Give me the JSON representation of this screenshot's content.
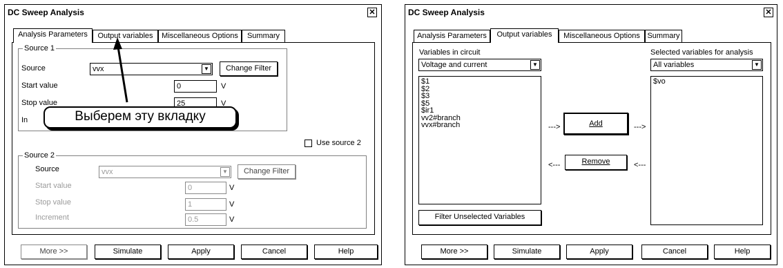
{
  "left_dialog": {
    "title": "DC Sweep Analysis",
    "close_glyph": "✕",
    "tabs": [
      {
        "label": "Analysis Parameters"
      },
      {
        "label": "Output variables"
      },
      {
        "label": "Miscellaneous Options"
      },
      {
        "label": "Summary"
      }
    ],
    "source1": {
      "legend": "Source 1",
      "source_label": "Source",
      "source_value": "vvx",
      "change_filter": "Change Filter",
      "start_label": "Start value",
      "start_value": "0",
      "stop_label": "Stop value",
      "stop_value": "25",
      "increment_label_partial": "In",
      "unit": "V"
    },
    "use_source_label": "Use source 2",
    "source2": {
      "legend": "Source 2",
      "source_label": "Source",
      "source_value": "vvx",
      "change_filter": "Change Filter",
      "start_label": "Start value",
      "start_value": "0",
      "stop_label": "Stop value",
      "stop_value": "1",
      "increment_label": "Increment",
      "increment_value": "0.5",
      "unit": "V"
    },
    "buttons": {
      "more": "More >>",
      "simulate": "Simulate",
      "apply": "Apply",
      "cancel": "Cancel",
      "help": "Help"
    },
    "callout_text": "Выберем эту вкладку"
  },
  "right_dialog": {
    "title": "DC Sweep Analysis",
    "close_glyph": "✕",
    "tabs": [
      {
        "label": "Analysis Parameters"
      },
      {
        "label": "Output variables"
      },
      {
        "label": "Miscellaneous Options"
      },
      {
        "label": "Summary"
      }
    ],
    "vars_label": "Variables in circuit",
    "vars_filter": "Voltage and current",
    "vars_list": [
      "$1",
      "$2",
      "$3",
      "$5",
      "$ir1",
      "vv2#branch",
      "vvx#branch"
    ],
    "selected_label": "Selected variables for analysis",
    "selected_filter": "All variables",
    "selected_list": [
      "$vo"
    ],
    "add_label": "Add",
    "remove_label": "Remove",
    "arrow_right": "--->",
    "arrow_left": "<---",
    "filter_unselected": "Filter Unselected Variables",
    "buttons": {
      "more": "More >>",
      "simulate": "Simulate",
      "apply": "Apply",
      "cancel": "Cancel",
      "help": "Help"
    }
  }
}
